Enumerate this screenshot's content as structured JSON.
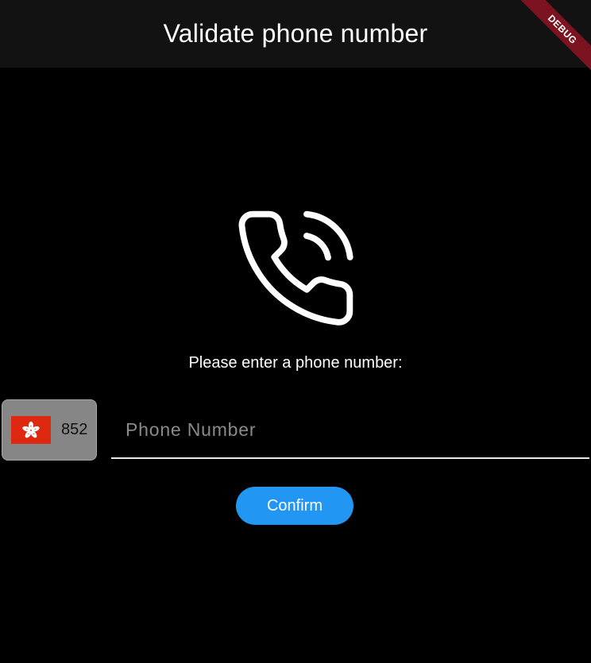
{
  "appbar": {
    "title": "Validate phone number",
    "background": "#121212"
  },
  "debug_banner": {
    "label": "DEBUG",
    "color": "#7b1420"
  },
  "main": {
    "icon": "phone-call-icon",
    "prompt": "Please enter a phone number:",
    "country_picker": {
      "flag": "hong-kong-flag-icon",
      "dial_code": "852"
    },
    "phone_input": {
      "value": "",
      "placeholder": "Phone Number"
    },
    "confirm_label": "Confirm"
  },
  "colors": {
    "background": "#000000",
    "accent": "#2196f3",
    "picker_background": "#868686",
    "flag_red": "#de2910"
  }
}
